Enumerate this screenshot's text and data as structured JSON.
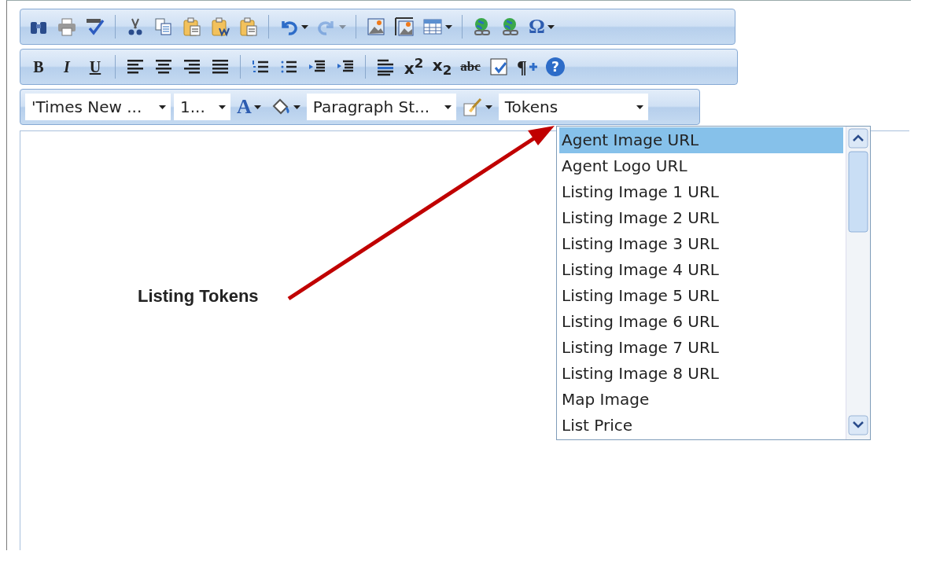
{
  "toolbars": [
    {
      "items": [
        {
          "kind": "find"
        },
        {
          "kind": "print"
        },
        {
          "kind": "spellcheck"
        },
        {
          "kind": "separator"
        },
        {
          "kind": "cut"
        },
        {
          "kind": "copy"
        },
        {
          "kind": "paste"
        },
        {
          "kind": "paste-word"
        },
        {
          "kind": "paste-text"
        },
        {
          "kind": "separator"
        },
        {
          "kind": "undo",
          "has_menu": true,
          "disabled": false
        },
        {
          "kind": "redo",
          "has_menu": true,
          "disabled": true
        },
        {
          "kind": "separator"
        },
        {
          "kind": "image"
        },
        {
          "kind": "image-manager"
        },
        {
          "kind": "table",
          "has_menu": true
        },
        {
          "kind": "separator"
        },
        {
          "kind": "link"
        },
        {
          "kind": "unlink"
        },
        {
          "kind": "omega",
          "label": "Ω",
          "has_menu": true
        }
      ]
    },
    {
      "items": [
        {
          "kind": "bold",
          "label": "B"
        },
        {
          "kind": "italic",
          "label": "I"
        },
        {
          "kind": "underline",
          "label": "U"
        },
        {
          "kind": "separator"
        },
        {
          "kind": "align-left"
        },
        {
          "kind": "align-center"
        },
        {
          "kind": "align-right"
        },
        {
          "kind": "justify"
        },
        {
          "kind": "separator"
        },
        {
          "kind": "ordered-list"
        },
        {
          "kind": "bullet-list"
        },
        {
          "kind": "outdent"
        },
        {
          "kind": "indent"
        },
        {
          "kind": "separator"
        },
        {
          "kind": "rule"
        },
        {
          "kind": "superscript",
          "label": "x$^{2}$"
        },
        {
          "kind": "subscript",
          "label": "x$_{2}$"
        },
        {
          "kind": "strike",
          "label": "abc"
        },
        {
          "kind": "form"
        },
        {
          "kind": "pilcrow",
          "label": "¶"
        },
        {
          "kind": "help",
          "label": "?"
        }
      ]
    }
  ],
  "format_bar": {
    "font": "'Times New ...",
    "size": "1...",
    "font_color": {
      "label": "A"
    },
    "paragraph_style": "Paragraph St...",
    "tokens": "Tokens"
  },
  "token_list": [
    {
      "label": "Agent Image URL",
      "selected": true
    },
    {
      "label": "Agent Logo URL",
      "selected": false
    },
    {
      "label": "Listing Image 1 URL",
      "selected": false
    },
    {
      "label": "Listing Image 2 URL",
      "selected": false
    },
    {
      "label": "Listing Image 3 URL",
      "selected": false
    },
    {
      "label": "Listing Image 4 URL",
      "selected": false
    },
    {
      "label": "Listing Image 5 URL",
      "selected": false
    },
    {
      "label": "Listing Image 6 URL",
      "selected": false
    },
    {
      "label": "Listing Image 7 URL",
      "selected": false
    },
    {
      "label": "Listing Image 8 URL",
      "selected": false
    },
    {
      "label": "Map Image",
      "selected": false
    },
    {
      "label": "List Price",
      "selected": false
    }
  ],
  "annotation": {
    "text": "Listing Tokens"
  }
}
